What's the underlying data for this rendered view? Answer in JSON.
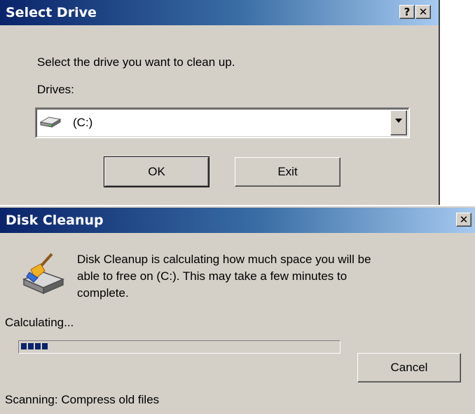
{
  "select_drive": {
    "title": "Select Drive",
    "help_label": "?",
    "close_label": "✕",
    "prompt": "Select the drive you want to clean up.",
    "drives_label": "Drives:",
    "selected_drive": "(C:)",
    "ok_label": "OK",
    "exit_label": "Exit"
  },
  "disk_cleanup": {
    "title": "Disk Cleanup",
    "close_label": "✕",
    "message_line1": "Disk Cleanup is calculating how much space you will be",
    "message_line2": "able to free on  (C:). This may take a few minutes to",
    "message_line3": "complete.",
    "calculating_label": "Calculating...",
    "progress_fraction": 0.08,
    "cancel_label": "Cancel",
    "scanning_label": "Scanning:  Compress old files"
  },
  "icons": {
    "drive": "hard-drive-icon",
    "cleanup": "disk-cleanup-broom-icon"
  }
}
